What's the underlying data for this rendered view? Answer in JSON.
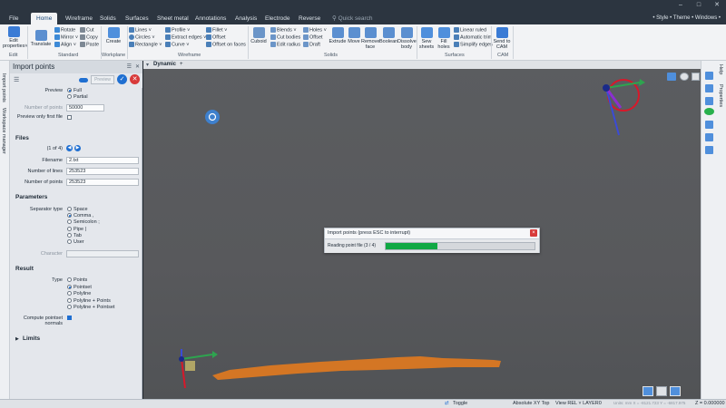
{
  "menu": {
    "file": "File",
    "tabs": [
      "Home",
      "Wireframe",
      "Solids",
      "Surfaces",
      "Sheet metal",
      "Annotations",
      "Analysis",
      "Electrode",
      "Reverse"
    ],
    "active_tab": "Home",
    "search_placeholder": "Quick search",
    "right": "• Style • Theme • Windows •"
  },
  "ribbon": {
    "edit": {
      "edit_label": "Edit",
      "properties": "properties˅",
      "group": "Edit"
    },
    "standard": {
      "translate": "Translate",
      "rotate": "Rotate",
      "mirror": "Mirror ˅",
      "align": "Align ˅",
      "cut": "Cut",
      "copy": "Copy",
      "paste": "Paste",
      "group": "Standard"
    },
    "workplane": {
      "create": "Create",
      "group": "Workplane"
    },
    "wireframe": {
      "lines": "Lines ˅",
      "circles": "Circles ˅",
      "rectangle": "Rectangle ˅",
      "profile": "Profile ˅",
      "extract_edges": "Extract edges ˅",
      "curve": "Curve ˅",
      "fillet": "Fillet ˅",
      "offset": "Offset",
      "offset_faces": "Offset on faces",
      "group": "Wireframe"
    },
    "solids": {
      "cuboid": "Cuboid",
      "blends": "Blends ˅",
      "cut_bodies": "Cut bodies",
      "edit_radius": "Edit radius",
      "holes": "Holes ˅",
      "offset": "Offset",
      "draft": "Draft",
      "extrude": "Extrude",
      "move": "Move",
      "remove_face": "Remove face",
      "boolean": "Boolean",
      "dissolve_body": "Dissolve body",
      "group": "Solids"
    },
    "surfaces": {
      "sew": "Sew sheets",
      "fill": "Fill holes",
      "linear": "Linear ruled",
      "auto_trim": "Automatic trim",
      "simplify": "Simplify edges",
      "group": "Surfaces"
    },
    "cam": {
      "send": "Send to CAM",
      "group": "CAM"
    }
  },
  "vstrip": {
    "tab1": "Import points",
    "tab2": "Workspace manager"
  },
  "panel": {
    "title": "Import points",
    "preview_btn": "Preview",
    "preview_label": "Preview",
    "preview_options": [
      "Full",
      "Partial"
    ],
    "num_points_label": "Number of points",
    "num_points_value": "50000",
    "preview_first_label": "Preview only first file",
    "files_section": "Files",
    "files_nav": "(1 of 4)",
    "filename_label": "Filename",
    "filename_value": "2.txt",
    "lines_label": "Number of lines",
    "lines_value": "253523",
    "points_label": "Number of points",
    "points_value": "253523",
    "params_section": "Parameters",
    "sep_label": "Separator type",
    "sep_options": [
      "Space",
      "Comma ,",
      "Semicolon ;",
      "Pipe |",
      "Tab",
      "User"
    ],
    "character_label": "Character",
    "result_section": "Result",
    "type_label": "Type",
    "type_options": [
      "Points",
      "Pointset",
      "Polyline",
      "Polyline + Points",
      "Polyline + Pointset"
    ],
    "compute_label": "Compute pointset normals",
    "limits_section": "Limits"
  },
  "view": {
    "tab": "Dynamic",
    "plus": "+"
  },
  "dialog": {
    "title": "Import points (press ESC to interrupt)",
    "message": "Reading point file (3 / 4)",
    "progress": 0.35
  },
  "status": {
    "toggle": "Toggle",
    "absolute": "Absolute XY Top",
    "view": "View REL ˅ LAYER0",
    "units": "Units: mm X = -8121.723 Y = -6817.975",
    "z": "Z = 0.000000"
  },
  "rstrip": {
    "help": "Help",
    "properties": "Properties"
  },
  "colors": {
    "accent": "#1f6fd1",
    "progress": "#11a944",
    "point_cloud": "#e07a1f"
  }
}
